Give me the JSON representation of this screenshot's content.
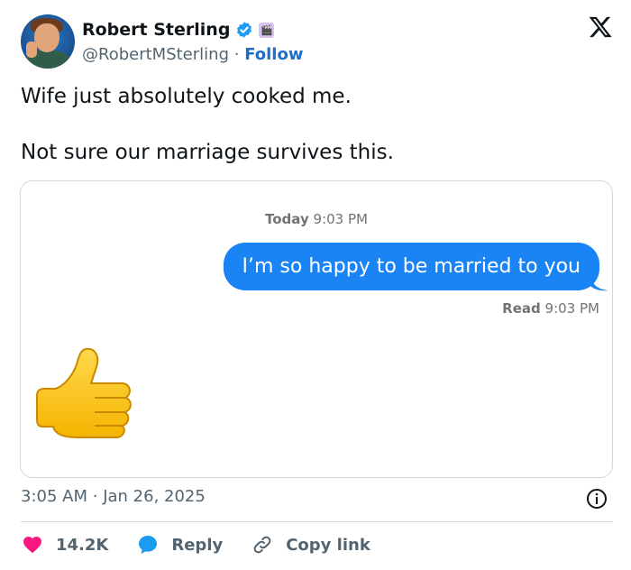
{
  "author": {
    "name": "Robert Sterling",
    "handle": "@RobertMSterling",
    "separator": "·",
    "follow_label": "Follow",
    "badge_emoji": "🎬"
  },
  "tweet": {
    "lines": [
      "Wife just absolutely cooked me.",
      "Not sure our marriage survives this."
    ]
  },
  "media": {
    "timestamp_day": "Today",
    "timestamp_time": "9:03 PM",
    "sent_message": "I’m so happy to be married to you",
    "read_label": "Read",
    "read_time": "9:03 PM",
    "reply_icon": "thumbs-up-emoji"
  },
  "footer": {
    "time": "3:05 AM",
    "separator": "·",
    "date": "Jan 26, 2025"
  },
  "actions": {
    "likes": "14.2K",
    "reply_label": "Reply",
    "copy_link_label": "Copy link"
  },
  "colors": {
    "brand_blue": "#1d9bf0",
    "follow_blue": "#1d6ec9",
    "imessage_blue": "#1a84f5",
    "like_pink": "#f91880",
    "muted_text": "#536471"
  }
}
